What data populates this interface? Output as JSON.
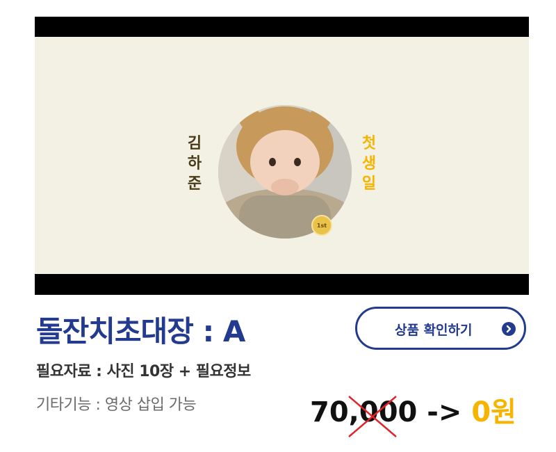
{
  "banner": {
    "name_chars": [
      "김",
      "하",
      "준"
    ],
    "title_chars": [
      "첫",
      "생",
      "일"
    ],
    "badge_text": "1st",
    "colors": {
      "frame": "#000000",
      "background": "#f3f0e4",
      "name": "#4a3a18",
      "title": "#f5b400"
    }
  },
  "product": {
    "title": "돌잔치초대장 : A",
    "check_button_label": "상품 확인하기",
    "check_button_icon": "chevron-right-circle-icon",
    "required_info": "필요자료 : 사진 10장 + 필요정보",
    "extra_features": "기타기능 : 영상 삽입 가능",
    "old_price": "70,000",
    "arrow": " -> ",
    "new_price": "0원",
    "colors": {
      "accent": "#233b8f",
      "price_highlight": "#f5b400",
      "strike": "#e0242a"
    }
  }
}
